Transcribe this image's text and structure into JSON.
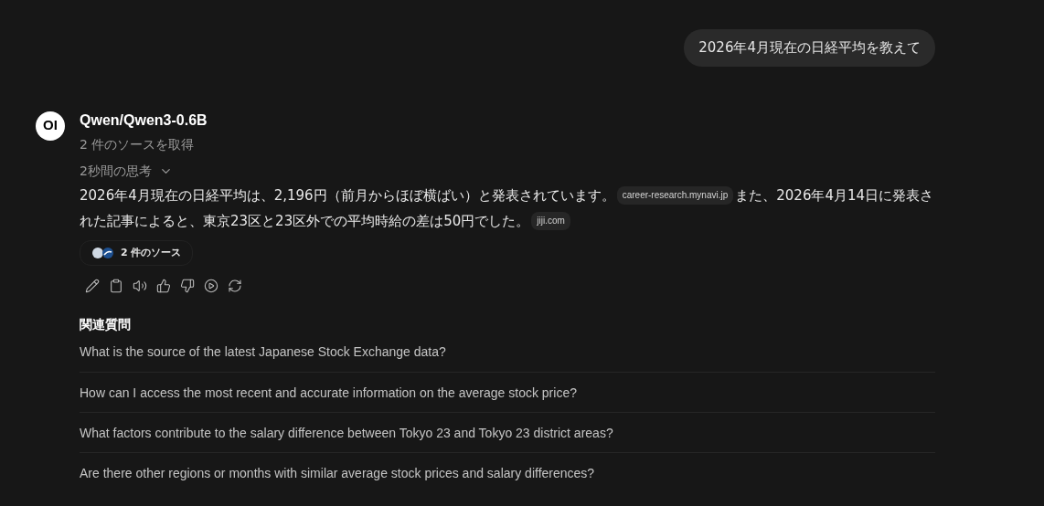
{
  "user_message": "2026年4月現在の日経平均を教えて",
  "assistant": {
    "avatar": "OI",
    "model": "Qwen/Qwen3-0.6B",
    "sources_status": "2 件のソースを取得",
    "thinking": {
      "label": "2秒間の思考",
      "expanded": false
    },
    "content": [
      {
        "kind": "text",
        "text": "2026年4月現在の日経平均は、2,196円（前月からほぼ横ばい）と発表されています。"
      },
      {
        "kind": "source",
        "text": "career-research.mynavi.jp"
      },
      {
        "kind": "text",
        "text": "また、2026年4月14日に発表された記事によると、東京23区と23区外での平均時給の差は50円でした。"
      },
      {
        "kind": "source",
        "text": "jiji.com"
      }
    ],
    "sources_button": "2 件のソース"
  },
  "related": {
    "title": "関連質問",
    "questions": [
      "What is the source of the latest Japanese Stock Exchange data?",
      "How can I access the most recent and accurate information on the average stock price?",
      "What factors contribute to the salary difference between Tokyo 23 and Tokyo 23 district areas?",
      "Are there other regions or months with similar average stock prices and salary differences?"
    ]
  }
}
